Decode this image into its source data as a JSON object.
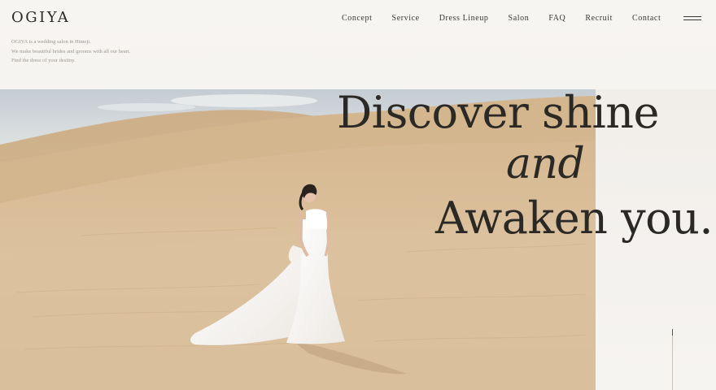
{
  "brand": {
    "logo": "OGIYA",
    "tagline": [
      "OGIYA is a wedding salon in Himeji.",
      "We make beautiful brides and grooms with all our heart.",
      "Find the dress of your destiny."
    ]
  },
  "nav": {
    "items": [
      {
        "label": "Concept"
      },
      {
        "label": "Service"
      },
      {
        "label": "Dress Lineup"
      },
      {
        "label": "Salon"
      },
      {
        "label": "FAQ"
      },
      {
        "label": "Recruit"
      },
      {
        "label": "Contact"
      }
    ],
    "menu_icon": "hamburger-icon"
  },
  "hero": {
    "headline_line1": "Discover shine",
    "headline_line2": "and",
    "headline_line3": "Awaken you.",
    "image_subject": "bride in white gown on sand dunes"
  },
  "colors": {
    "background": "#f6f4f1",
    "text": "#2b2926",
    "sand": "#d9bf9a",
    "sky": "#cfd6dc"
  }
}
